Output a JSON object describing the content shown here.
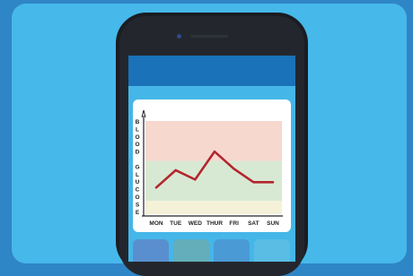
{
  "chart_data": {
    "type": "line",
    "ylabel": "BLOOD GLUCOSE",
    "categories": [
      "MON",
      "TUE",
      "WED",
      "THUR",
      "FRI",
      "SAT",
      "SUN"
    ],
    "series": [
      {
        "values": [
          2.0,
          3.3,
          2.6,
          4.7,
          3.4,
          2.4,
          2.4
        ],
        "color": "#b3262d"
      }
    ],
    "ylim": [
      0,
      7
    ],
    "bands": [
      {
        "from": 0,
        "to": 1,
        "color": "#f5f1d8"
      },
      {
        "from": 1,
        "to": 4,
        "color": "#d8e9d3"
      },
      {
        "from": 4,
        "to": 7,
        "color": "#f6d8cf"
      }
    ],
    "grid": false
  },
  "icons": {
    "camera": "front-camera-icon",
    "speaker": "earpiece-speaker-icon"
  }
}
